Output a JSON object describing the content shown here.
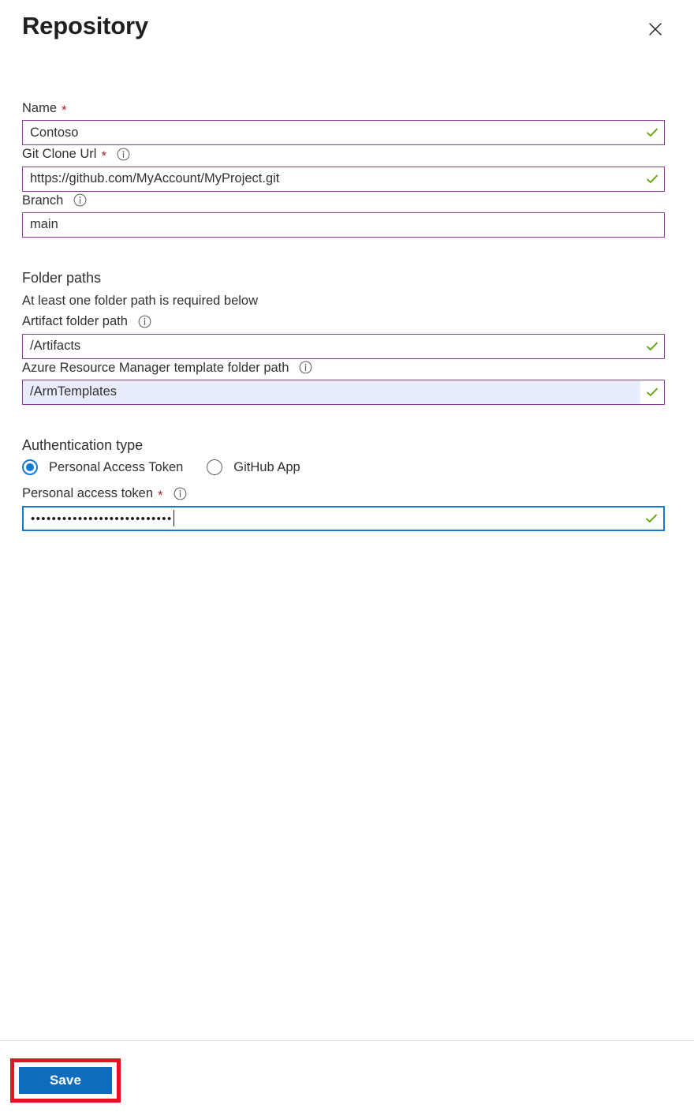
{
  "header": {
    "title": "Repository",
    "close_icon": "close-icon"
  },
  "form": {
    "name": {
      "label": "Name",
      "required_marker": "*",
      "value": "Contoso",
      "placeholder": "",
      "valid": true
    },
    "git_clone_url": {
      "label": "Git Clone Url",
      "required_marker": "*",
      "info_icon": "info-icon",
      "value": "https://github.com/MyAccount/MyProject.git",
      "placeholder": "",
      "valid": true
    },
    "branch": {
      "label": "Branch",
      "info_icon": "info-icon",
      "value": "main",
      "placeholder": "",
      "valid": false
    },
    "folder_paths": {
      "section_title": "Folder paths",
      "note": "At least one folder path is required below",
      "artifact": {
        "label": "Artifact folder path",
        "info_icon": "info-icon",
        "value": "/Artifacts",
        "placeholder": "",
        "valid": true
      },
      "arm_template": {
        "label": "Azure Resource Manager template folder path",
        "info_icon": "info-icon",
        "value": "/ArmTemplates",
        "placeholder": "",
        "valid": true,
        "selected": true
      }
    },
    "authentication": {
      "section_title": "Authentication type",
      "options": [
        {
          "label": "Personal Access Token",
          "checked": true
        },
        {
          "label": "GitHub App",
          "checked": false
        }
      ],
      "token": {
        "label": "Personal access token",
        "required_marker": "*",
        "info_icon": "info-icon",
        "masked_value": "•••••••••••••••••••••••••••",
        "valid": true,
        "focused": true
      }
    }
  },
  "footer": {
    "save_label": "Save"
  },
  "colors": {
    "field_border": "#8e3a9c",
    "focus_border": "#0f7ad8",
    "selected_field_bg": "#e7edfb",
    "valid_check": "#5aa304",
    "required_star": "#a4262c",
    "primary_button": "#0f6cbd",
    "highlight_box": "#e81123",
    "radio_accent": "#0f7ad8",
    "text": "#323130"
  }
}
